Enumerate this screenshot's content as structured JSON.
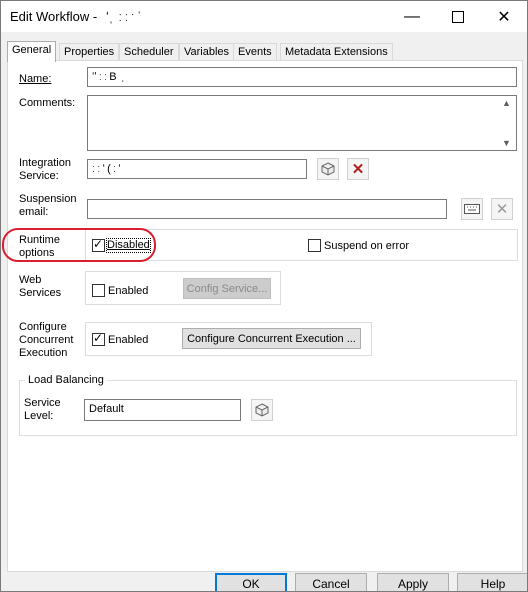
{
  "window": {
    "title": "Edit Workflow -   ʻˌ  ː ː ˑ ˈ",
    "minimize_icon": "minimize-icon",
    "maximize_icon": "maximize-icon",
    "close_icon": "close-icon"
  },
  "tabs": [
    "General",
    "Properties",
    "Scheduler",
    "Variables",
    "Events",
    "Metadata Extensions"
  ],
  "active_tab": "General",
  "general": {
    "name_label": "Name:",
    "name_value": "ʻʹ ː ː B  ˌ",
    "comments_label": "Comments:",
    "comments_value": "",
    "integration_label_1": "Integration",
    "integration_label_2": "Service:",
    "integration_value": "ː ː ʻ ( ː ʻ",
    "suspension_label_1": "Suspension",
    "suspension_label_2": "email:",
    "suspension_value": "",
    "runtime_label_1": "Runtime",
    "runtime_label_2": "options",
    "disabled_label": "Disabled",
    "disabled_checked": true,
    "suspend_on_error_label": "Suspend on error",
    "suspend_on_error_checked": false,
    "web_label_1": "Web",
    "web_label_2": "Services",
    "web_enabled_label": "Enabled",
    "web_enabled_checked": false,
    "config_service_label": "Config Service...",
    "concurrent_label_1": "Configure",
    "concurrent_label_2": "Concurrent",
    "concurrent_label_3": "Execution",
    "concurrent_enabled_label": "Enabled",
    "concurrent_enabled_checked": true,
    "configure_concurrent_label": "Configure Concurrent Execution ...",
    "load_balancing_title": "Load Balancing",
    "service_level_label_1": "Service",
    "service_level_label_2": "Level:",
    "service_level_value": "Default"
  },
  "footer": {
    "ok": "OK",
    "cancel": "Cancel",
    "apply": "Apply",
    "help": "Help"
  },
  "colors": {
    "highlight_oval": "#d82030",
    "delete_x": "#b02020"
  }
}
